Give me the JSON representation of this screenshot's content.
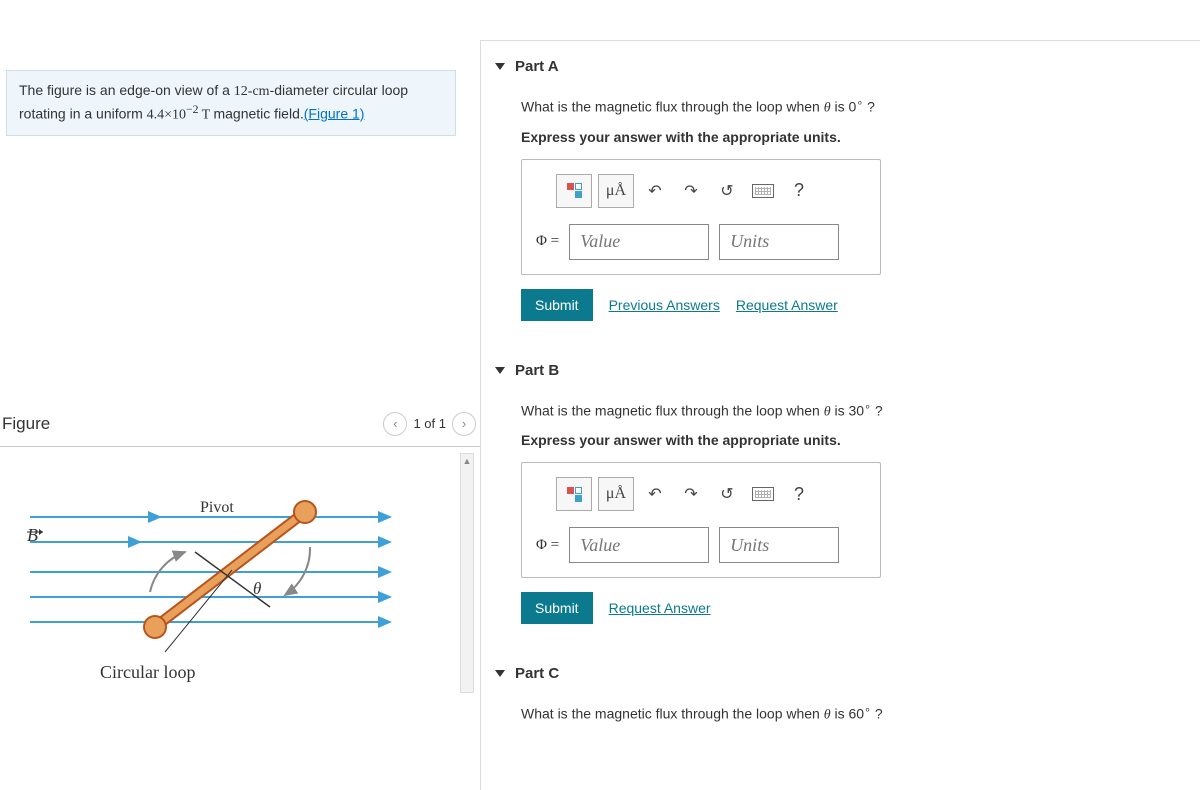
{
  "problem": {
    "text_before": "The figure is an edge-on view of a ",
    "diameter": "12-cm",
    "text_mid1": "-diameter circular loop rotating in a uniform ",
    "field": "4.4×10",
    "exp": "−2",
    "unit": " T ",
    "text_after": "magnetic field.",
    "figure_link": "(Figure 1)"
  },
  "figure": {
    "title": "Figure",
    "pager": "1 of 1",
    "labels": {
      "B": "B",
      "pivot": "Pivot",
      "theta": "θ",
      "loop": "Circular loop"
    }
  },
  "parts": {
    "a": {
      "title": "Part A",
      "question_pre": "What is the magnetic flux through the loop when ",
      "angle": "0",
      "question_post": " ?",
      "instruction": "Express your answer with the appropriate units.",
      "phi": "Φ =",
      "value_ph": "Value",
      "units_ph": "Units",
      "submit": "Submit",
      "prev": "Previous Answers",
      "req": "Request Answer",
      "mu": "μÅ",
      "help": "?"
    },
    "b": {
      "title": "Part B",
      "question_pre": "What is the magnetic flux through the loop when ",
      "angle": "30",
      "question_post": " ?",
      "instruction": "Express your answer with the appropriate units.",
      "phi": "Φ =",
      "value_ph": "Value",
      "units_ph": "Units",
      "submit": "Submit",
      "req": "Request Answer",
      "mu": "μÅ",
      "help": "?"
    },
    "c": {
      "title": "Part C",
      "question_pre": "What is the magnetic flux through the loop when ",
      "angle": "60",
      "question_post": " ?"
    }
  }
}
